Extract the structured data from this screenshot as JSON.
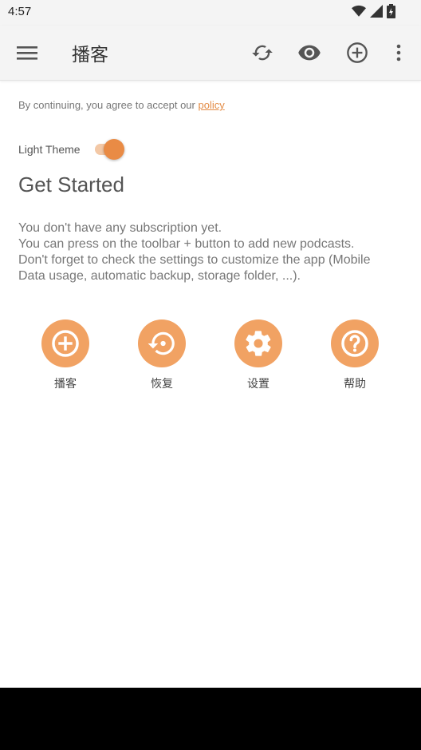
{
  "status_bar": {
    "time": "4:57",
    "icons": [
      "wifi-icon",
      "signal-icon",
      "battery-icon"
    ]
  },
  "toolbar": {
    "menu_icon": "menu-icon",
    "title": "播客",
    "actions": [
      "refresh-icon",
      "eye-icon",
      "add-circle-icon",
      "more-vert-icon"
    ]
  },
  "policy": {
    "text": "By continuing, you agree to accept our ",
    "link": "policy"
  },
  "theme": {
    "label": "Light Theme",
    "enabled": true
  },
  "heading": "Get Started",
  "description": [
    "You don't have any subscription yet.",
    "You can press on the toolbar + button to add new podcasts.",
    "Don't forget to check the settings to customize the app (Mobile",
    "Data usage, automatic backup, storage folder, ...)."
  ],
  "actions": [
    {
      "label": "播客",
      "icon": "add-circle-icon"
    },
    {
      "label": "恢复",
      "icon": "restore-icon"
    },
    {
      "label": "设置",
      "icon": "settings-icon"
    },
    {
      "label": "帮助",
      "icon": "help-icon"
    }
  ],
  "colors": {
    "accent": "#e98b45",
    "action_fill": "#f1a263",
    "bar_bg": "#f4f4f4"
  }
}
